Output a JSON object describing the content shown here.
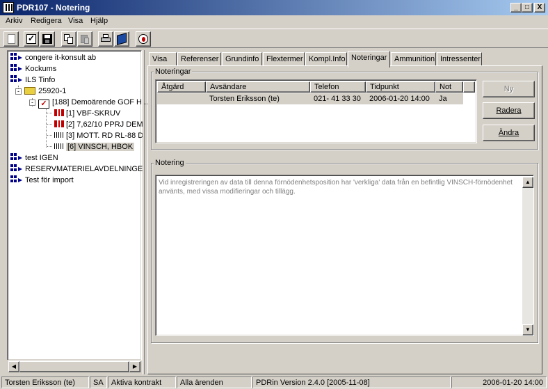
{
  "window": {
    "title": "PDR107 - Notering",
    "minimize": "_",
    "maximize": "□",
    "close": "X"
  },
  "menu": [
    "Arkiv",
    "Redigera",
    "Visa",
    "Hjälp"
  ],
  "toolbar": {
    "buttons": [
      "new-document-icon",
      "checklist-icon",
      "save-icon",
      "copy-icon",
      "paste-icon",
      "print-icon",
      "book-icon",
      "info-globe-icon"
    ]
  },
  "tree": {
    "items": [
      {
        "label": "congere it-konsult ab",
        "icon": "organization-icon"
      },
      {
        "label": "Kockums",
        "icon": "organization-icon"
      },
      {
        "label": "ILS Tinfo",
        "icon": "organization-icon"
      },
      {
        "label": "25920-1",
        "icon": "folder-icon",
        "expander": "-"
      },
      {
        "label": "[188] Demoärende GOF H...",
        "icon": "case-check-icon",
        "expander": "-"
      },
      {
        "label": "[1] VBF-SKRUV",
        "icon": "red-part-icon"
      },
      {
        "label": "[2] 7,62/10 PPRJ DEM",
        "icon": "red-part-icon"
      },
      {
        "label": "[3] MOTT. RD RL-88 D",
        "icon": "barcode-icon"
      },
      {
        "label": "[6] VINSCH, HBOK",
        "icon": "barcode-icon"
      },
      {
        "label": "test IGEN",
        "icon": "organization-icon"
      },
      {
        "label": "RESERVMATERIELAVDELNINGE",
        "icon": "organization-icon"
      },
      {
        "label": "Test för import",
        "icon": "organization-icon"
      }
    ]
  },
  "tabs": [
    "Visa",
    "Referenser",
    "Grundinfo",
    "Flextermer",
    "Kompl.Info",
    "Noteringar",
    "Ammunition",
    "Intressenter"
  ],
  "active_tab": "Noteringar",
  "noteringar": {
    "legend": "Noteringar",
    "columns": [
      "Åtgärd",
      "Avsändare",
      "Telefon",
      "Tidpunkt",
      "Not"
    ],
    "rows": [
      [
        "",
        "Torsten Eriksson (te)",
        "021- 41 33 30",
        "2006-01-20 14:00",
        "Ja"
      ]
    ],
    "buttons": {
      "new": "Ny",
      "delete": "Radera",
      "edit": "Ändra"
    }
  },
  "notering": {
    "legend": "Notering",
    "text": "Vid inregistreringen av data till denna förnödenhetsposition har 'verkliga' data från en befintlig VINSCH-förnödenhet använts, med vissa modifieringar och tillägg."
  },
  "status": {
    "user": "Torsten Eriksson (te)",
    "initials": "SA",
    "contracts": "Aktiva kontrakt",
    "cases": "Alla ärenden",
    "version": "PDRin Version 2.4.0 [2005-11-08]",
    "datetime": "2006-01-20  14:00"
  }
}
